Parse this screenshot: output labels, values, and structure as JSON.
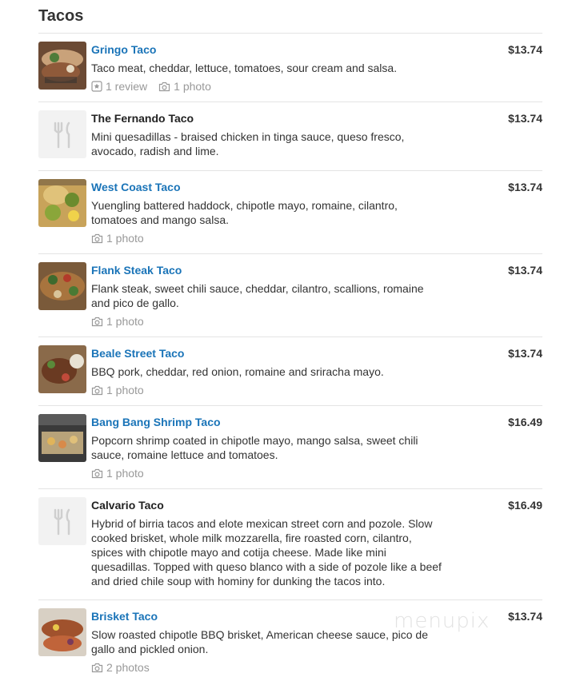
{
  "section": {
    "title": "Tacos"
  },
  "watermark": "menupix",
  "items": [
    {
      "name": "Gringo Taco",
      "linked": true,
      "price": "$13.74",
      "description": "Taco meat, cheddar, lettuce, tomatoes, sour cream and salsa.",
      "reviews": "1 review",
      "photos": "1 photo",
      "thumb": "photo"
    },
    {
      "name": "The Fernando Taco",
      "linked": false,
      "price": "$13.74",
      "description": "Mini quesadillas - braised chicken in tinga sauce, queso fresco, avocado, radish and lime.",
      "reviews": null,
      "photos": null,
      "thumb": "fork-knife-icon"
    },
    {
      "name": "West Coast Taco",
      "linked": true,
      "price": "$13.74",
      "description": "Yuengling battered haddock, chipotle mayo, romaine, cilantro, tomatoes and mango salsa.",
      "reviews": null,
      "photos": "1 photo",
      "thumb": "photo"
    },
    {
      "name": "Flank Steak Taco",
      "linked": true,
      "price": "$13.74",
      "description": "Flank steak, sweet chili sauce, cheddar, cilantro, scallions, romaine and pico de gallo.",
      "reviews": null,
      "photos": "1 photo",
      "thumb": "photo"
    },
    {
      "name": "Beale Street Taco",
      "linked": true,
      "price": "$13.74",
      "description": "BBQ pork, cheddar, red onion, romaine and sriracha mayo.",
      "reviews": null,
      "photos": "1 photo",
      "thumb": "photo"
    },
    {
      "name": "Bang Bang Shrimp Taco",
      "linked": true,
      "price": "$16.49",
      "description": "Popcorn shrimp coated in chipotle mayo, mango salsa, sweet chili sauce, romaine lettuce and tomatoes.",
      "reviews": null,
      "photos": "1 photo",
      "thumb": "photo"
    },
    {
      "name": "Calvario Taco",
      "linked": false,
      "price": "$16.49",
      "description": "Hybrid of birria tacos and elote mexican street corn and pozole. Slow cooked brisket, whole milk mozzarella, fire roasted corn, cilantro, spices with chipotle mayo and cotija cheese. Made like mini quesadillas. Topped with queso blanco with a side of pozole like a beef and dried chile soup with hominy for dunking the tacos into.",
      "reviews": null,
      "photos": null,
      "thumb": "fork-knife-icon"
    },
    {
      "name": "Brisket Taco",
      "linked": true,
      "price": "$13.74",
      "description": "Slow roasted chipotle BBQ brisket, American cheese sauce, pico de gallo and pickled onion.",
      "reviews": null,
      "photos": "2 photos",
      "thumb": "photo"
    }
  ]
}
